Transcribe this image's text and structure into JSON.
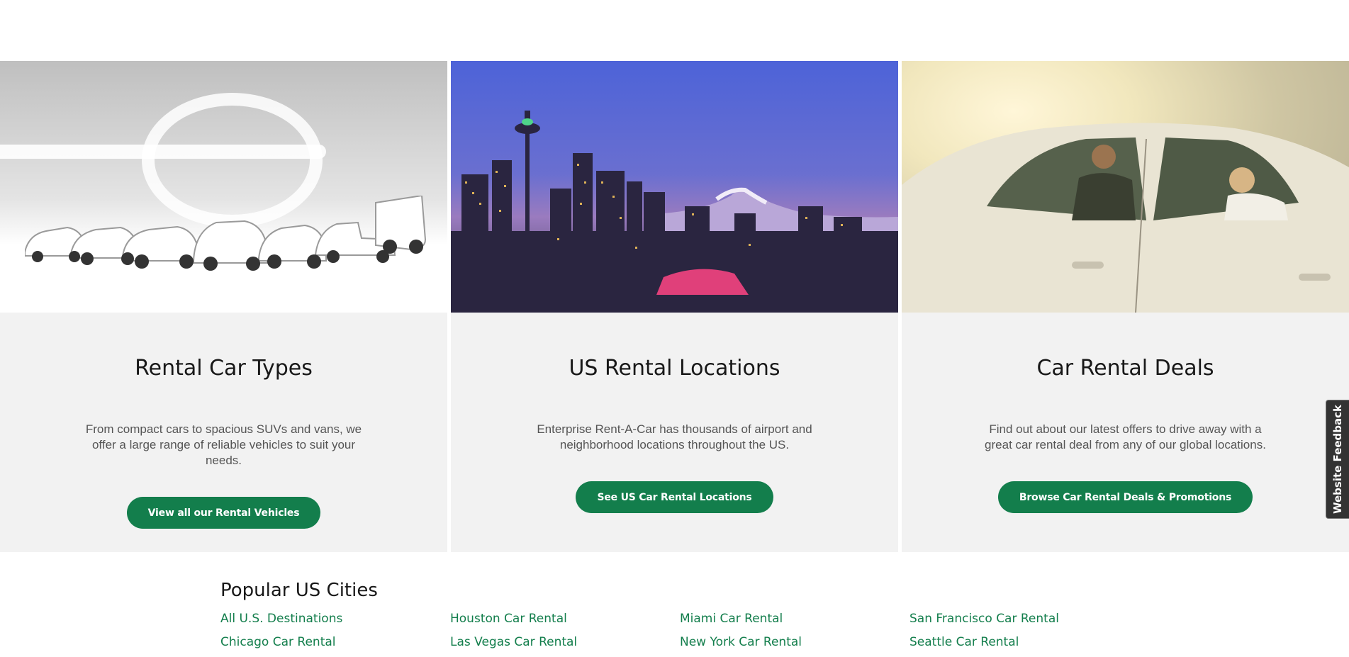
{
  "cards": [
    {
      "title": "Rental Car Types",
      "description": "From compact cars to spacious SUVs and vans, we offer a large range of reliable vehicles to suit your needs.",
      "button": "View all our Rental Vehicles",
      "image": "rental-fleet-photo"
    },
    {
      "title": "US Rental Locations",
      "description": "Enterprise Rent-A-Car has thousands of airport and neighborhood locations throughout the US.",
      "button": "See US Car Rental Locations",
      "image": "seattle-skyline-photo"
    },
    {
      "title": "Car Rental Deals",
      "description": "Find out about our latest offers to drive away with a great car rental deal from any of our global locations.",
      "button": "Browse Car Rental Deals & Promotions",
      "image": "people-in-car-photo"
    }
  ],
  "popular_cities": {
    "title": "Popular US Cities",
    "links": [
      "All U.S. Destinations",
      "Houston Car Rental",
      "Miami Car Rental",
      "San Francisco Car Rental",
      "Chicago Car Rental",
      "Las Vegas Car Rental",
      "New York Car Rental",
      "Seattle Car Rental"
    ]
  },
  "feedback_tab": "Website Feedback",
  "colors": {
    "brand_green": "#137e4c",
    "card_background": "#f2f2f2",
    "feedback_tab": "#333333"
  }
}
